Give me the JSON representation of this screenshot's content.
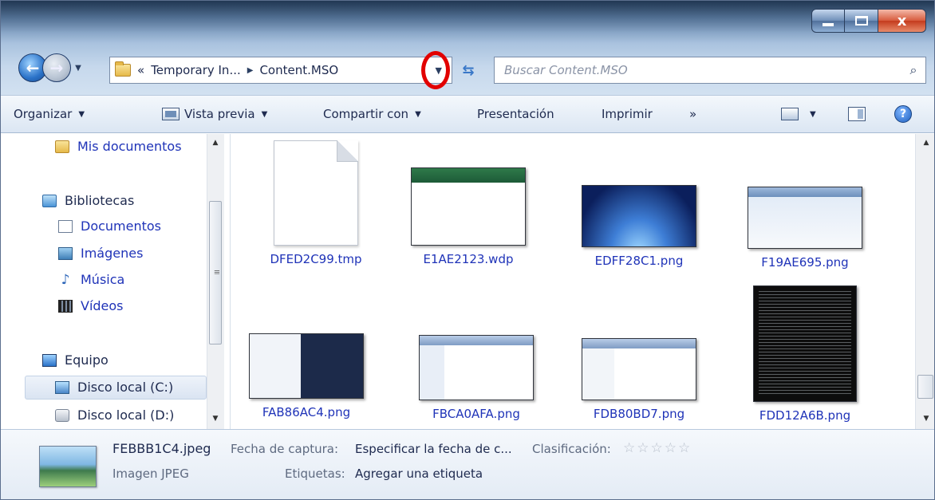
{
  "window": {
    "caption": {
      "minimize": "",
      "maximize": "",
      "close": "x"
    }
  },
  "address": {
    "overflow": "«",
    "crumbs": [
      "Temporary In...",
      "Content.MSO"
    ]
  },
  "search": {
    "placeholder": "Buscar Content.MSO"
  },
  "toolbar": {
    "organize": "Organizar",
    "preview": "Vista previa",
    "share": "Compartir con",
    "slideshow": "Presentación",
    "print": "Imprimir",
    "more": "»"
  },
  "navpane": {
    "items": [
      {
        "label": "Mis documentos",
        "icon": "folder-icon"
      },
      {
        "label": "Bibliotecas",
        "icon": "libraries-icon"
      },
      {
        "label": "Documentos",
        "icon": "document-icon"
      },
      {
        "label": "Imágenes",
        "icon": "pictures-icon"
      },
      {
        "label": "Música",
        "icon": "music-icon"
      },
      {
        "label": "Vídeos",
        "icon": "video-icon"
      },
      {
        "label": "Equipo",
        "icon": "computer-icon"
      },
      {
        "label": "Disco local (C:)",
        "icon": "drive-c-icon"
      },
      {
        "label": "Disco local (D:)",
        "icon": "drive-icon"
      }
    ]
  },
  "files": [
    {
      "name": "DFED2C99.tmp",
      "kind": "blank"
    },
    {
      "name": "E1AE2123.wdp",
      "kind": "dialog"
    },
    {
      "name": "EDFF28C1.png",
      "kind": "desktop"
    },
    {
      "name": "F19AE695.png",
      "kind": "run"
    },
    {
      "name": "FAB86AC4.png",
      "kind": "start"
    },
    {
      "name": "FBCA0AFA.png",
      "kind": "explorer"
    },
    {
      "name": "FDB80BD7.png",
      "kind": "explorer2"
    },
    {
      "name": "FDD12A6B.png",
      "kind": "cmd"
    }
  ],
  "details": {
    "filename": "FEBBB1C4.jpeg",
    "type": "Imagen JPEG",
    "date_label": "Fecha de captura:",
    "date_value": "Especificar la fecha de c...",
    "rating_label": "Clasificación:",
    "rating_stars": "☆☆☆☆☆",
    "tags_label": "Etiquetas:",
    "tags_value": "Agregar una etiqueta"
  }
}
